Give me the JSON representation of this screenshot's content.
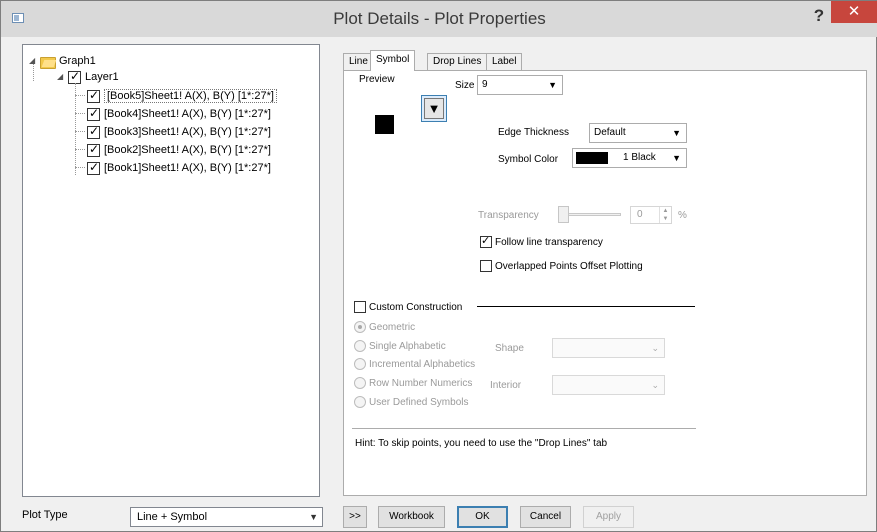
{
  "window": {
    "title": "Plot Details - Plot Properties",
    "help_label": "?",
    "close_label": "✕"
  },
  "tree": {
    "root": "Graph1",
    "layer": "Layer1",
    "datasets": [
      "[Book5]Sheet1! A(X), B(Y) [1*:27*]",
      "[Book4]Sheet1! A(X), B(Y) [1*:27*]",
      "[Book3]Sheet1! A(X), B(Y) [1*:27*]",
      "[Book2]Sheet1! A(X), B(Y) [1*:27*]",
      "[Book1]Sheet1! A(X), B(Y) [1*:27*]"
    ]
  },
  "plot_type": {
    "label": "Plot Type",
    "value": "Line + Symbol"
  },
  "tabs": [
    "Line",
    "Symbol",
    "Drop Lines",
    "Label"
  ],
  "active_tab": "Symbol",
  "symbol": {
    "preview_label": "Preview",
    "size_label": "Size",
    "size_value": "9",
    "symbol_glyph": "▼",
    "edge_thickness_label": "Edge Thickness",
    "edge_thickness_value": "Default",
    "symbol_color_label": "Symbol Color",
    "symbol_color_value": "1 Black",
    "symbol_color_hex": "#000000",
    "transparency_label": "Transparency",
    "transparency_value": "0",
    "transparency_unit": "%",
    "follow_line_transparency_label": "Follow line transparency",
    "follow_line_transparency_checked": true,
    "overlapped_offset_label": "Overlapped Points Offset Plotting",
    "overlapped_offset_checked": false,
    "custom_construction_label": "Custom Construction",
    "custom_construction_checked": false,
    "construction_options": [
      "Geometric",
      "Single Alphabetic",
      "Incremental Alphabetics",
      "Row Number Numerics",
      "User Defined Symbols"
    ],
    "construction_selected": "Geometric",
    "shape_label": "Shape",
    "interior_label": "Interior",
    "hint": "Hint: To skip points, you need to use the \"Drop Lines\" tab"
  },
  "buttons": {
    "expand": ">>",
    "workbook": "Workbook",
    "ok": "OK",
    "cancel": "Cancel",
    "apply": "Apply"
  }
}
